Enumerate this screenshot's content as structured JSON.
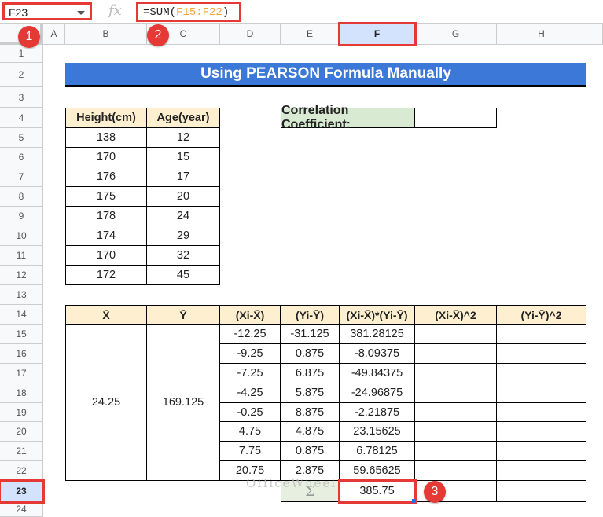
{
  "formula_bar": {
    "name_box": "F23",
    "fx": "fx",
    "formula_prefix": "=SUM(",
    "formula_ref": "F15:F22",
    "formula_suffix": ")"
  },
  "columns": [
    "A",
    "B",
    "C",
    "D",
    "E",
    "F",
    "G",
    "H"
  ],
  "rows": [
    "1",
    "2",
    "3",
    "4",
    "5",
    "6",
    "7",
    "8",
    "9",
    "10",
    "11",
    "12",
    "13",
    "14",
    "15",
    "16",
    "17",
    "18",
    "19",
    "20",
    "21",
    "22",
    "23",
    "24"
  ],
  "title": "Using PEARSON Formula Manually",
  "data_table": {
    "headers": [
      "Height(cm)",
      "Age(year)"
    ],
    "rows": [
      [
        "138",
        "12"
      ],
      [
        "170",
        "15"
      ],
      [
        "176",
        "17"
      ],
      [
        "175",
        "20"
      ],
      [
        "178",
        "24"
      ],
      [
        "174",
        "29"
      ],
      [
        "170",
        "32"
      ],
      [
        "172",
        "45"
      ]
    ]
  },
  "correlation": {
    "label": "Correlation Coefficient:",
    "value": ""
  },
  "calc_table": {
    "headers": [
      "X̄",
      "Ȳ",
      "(Xi-X̄)",
      "(Yi-Ȳ)",
      "(Xi-X̄)*(Yi-Ȳ)",
      "(Xi-X̄)^2",
      "(Yi-Ȳ)^2"
    ],
    "x_mean": "24.25",
    "y_mean": "169.125",
    "rows": [
      [
        "-12.25",
        "-31.125",
        "381.28125"
      ],
      [
        "-9.25",
        "0.875",
        "-8.09375"
      ],
      [
        "-7.25",
        "6.875",
        "-49.84375"
      ],
      [
        "-4.25",
        "5.875",
        "-24.96875"
      ],
      [
        "-0.25",
        "8.875",
        "-2.21875"
      ],
      [
        "4.75",
        "4.875",
        "23.15625"
      ],
      [
        "7.75",
        "0.875",
        "6.78125"
      ],
      [
        "20.75",
        "2.875",
        "59.65625"
      ]
    ],
    "sum_label": "Σ",
    "sum_value": "385.75"
  },
  "badges": [
    "1",
    "2",
    "3"
  ],
  "watermark": "OfficeWheel",
  "colors": {
    "title": "#3c78d8",
    "header": "#fdefcf",
    "green": "#d9ead3",
    "highlight": "#e53935"
  }
}
